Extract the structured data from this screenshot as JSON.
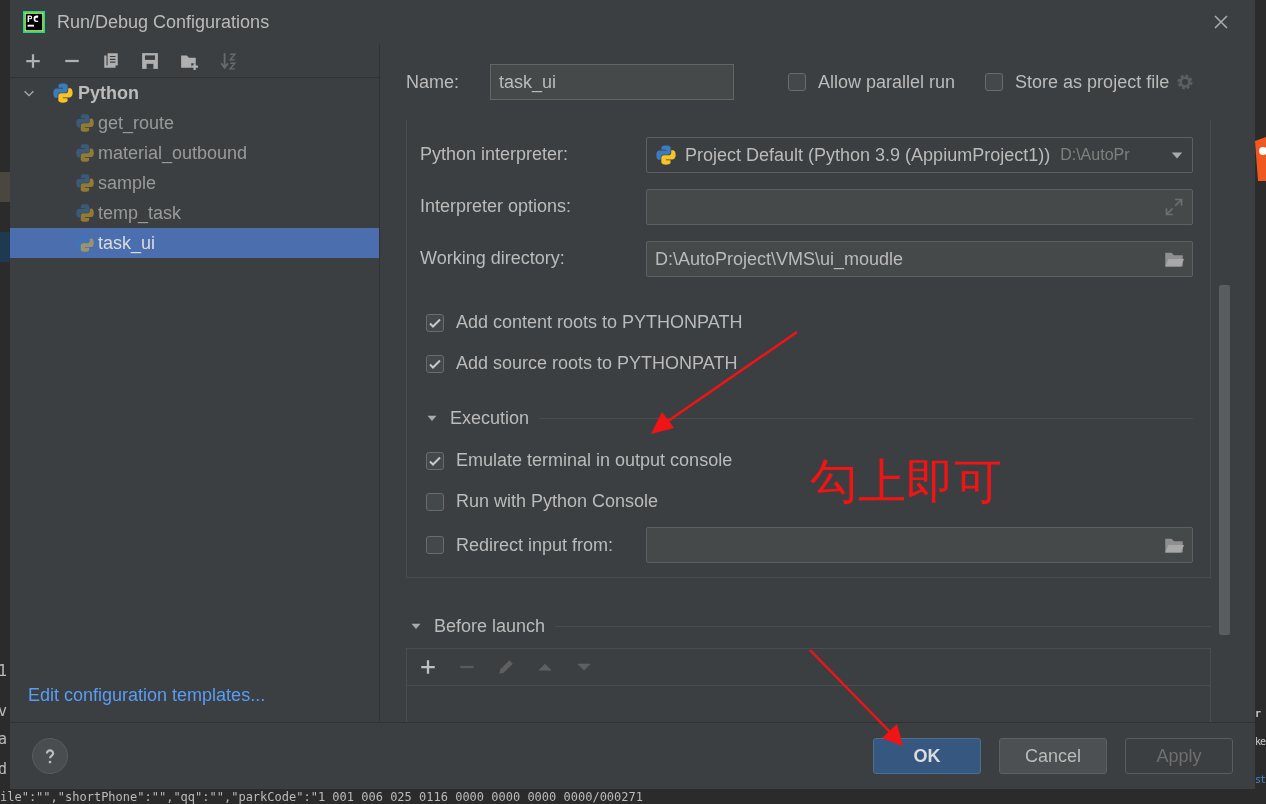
{
  "window": {
    "title": "Run/Debug Configurations"
  },
  "sidebar": {
    "tree": [
      {
        "label": "Python",
        "expanded": true,
        "selected": false,
        "children": [
          {
            "label": "get_route",
            "selected": false
          },
          {
            "label": "material_outbound",
            "selected": false
          },
          {
            "label": "sample",
            "selected": false
          },
          {
            "label": "temp_task",
            "selected": false
          },
          {
            "label": "task_ui",
            "selected": true
          }
        ]
      }
    ],
    "link": "Edit configuration templates..."
  },
  "name_row": {
    "label": "Name:",
    "value": "task_ui",
    "options": [
      {
        "label": "Allow parallel run",
        "checked": false
      },
      {
        "label": "Store as project file",
        "checked": false
      }
    ]
  },
  "fields": [
    {
      "kind": "select",
      "label": "Python interpreter:",
      "value": "Project Default (Python 3.9 (AppiumProject1))",
      "hint": "D:\\AutoPr"
    },
    {
      "kind": "expand",
      "label": "Interpreter options:"
    },
    {
      "kind": "folder",
      "label": "Working directory:",
      "value": "D:\\AutoProject\\VMS\\ui_moudle"
    }
  ],
  "path_options": [
    {
      "label": "Add content roots to PYTHONPATH",
      "checked": true
    },
    {
      "label": "Add source roots to PYTHONPATH",
      "checked": true
    }
  ],
  "execution": {
    "title": "Execution",
    "expanded": true,
    "items": [
      {
        "kind": "checkbox",
        "label": "Emulate terminal in output console",
        "checked": true
      },
      {
        "kind": "checkbox",
        "label": "Run with Python Console",
        "checked": false
      },
      {
        "kind": "file",
        "label": "Redirect input from:",
        "checked": false
      }
    ]
  },
  "before_launch": {
    "title": "Before launch",
    "expanded": true
  },
  "buttons": [
    {
      "label": "OK",
      "kind": "primary",
      "disabled": false
    },
    {
      "label": "Cancel",
      "kind": "normal",
      "disabled": false
    },
    {
      "label": "Apply",
      "kind": "normal",
      "disabled": true
    }
  ],
  "annotation": {
    "text": "勾上即可"
  },
  "background": {
    "left_fragments": [
      "1",
      "v",
      "a",
      "d"
    ],
    "right_fragments": [
      "r",
      "ke",
      "st"
    ],
    "code_line": "ile\":\"\",\"shortPhone\":\"\",\"qq\":\"\",\"parkCode\":\"1 001 006 025 0116 0000 0000 0000 0000/000271"
  }
}
